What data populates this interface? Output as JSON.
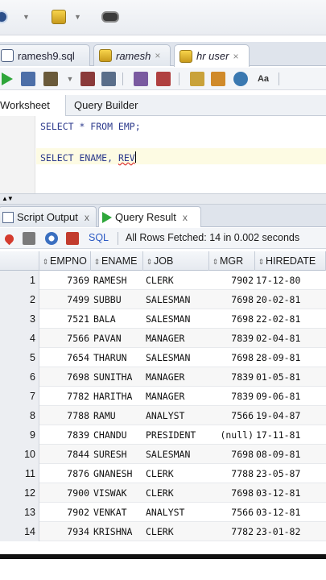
{
  "editor_tabs": [
    {
      "label": "ramesh9.sql",
      "close": "×"
    },
    {
      "label": "ramesh",
      "close": "×"
    },
    {
      "label": "hr user",
      "close": "×"
    }
  ],
  "worksheet_tabs": {
    "worksheet": "Worksheet",
    "query_builder": "Query Builder"
  },
  "editor": {
    "line1": "SELECT * FROM EMP;",
    "line2_prefix": "SELECT ENAME, ",
    "line2_error": "REV"
  },
  "result_tabs": [
    {
      "label": "Script Output",
      "close": "x"
    },
    {
      "label": "Query Result",
      "close": "x"
    }
  ],
  "result_toolbar": {
    "sql_label": "SQL",
    "fetch_status": "All Rows Fetched: 14 in 0.002 seconds"
  },
  "table": {
    "columns": [
      "EMPNO",
      "ENAME",
      "JOB",
      "MGR",
      "HIREDATE"
    ],
    "rows": [
      [
        "1",
        "7369",
        "RAMESH",
        "CLERK",
        "7902",
        "17-12-80"
      ],
      [
        "2",
        "7499",
        "SUBBU",
        "SALESMAN",
        "7698",
        "20-02-81"
      ],
      [
        "3",
        "7521",
        "BALA",
        "SALESMAN",
        "7698",
        "22-02-81"
      ],
      [
        "4",
        "7566",
        "PAVAN",
        "MANAGER",
        "7839",
        "02-04-81"
      ],
      [
        "5",
        "7654",
        "THARUN",
        "SALESMAN",
        "7698",
        "28-09-81"
      ],
      [
        "6",
        "7698",
        "SUNITHA",
        "MANAGER",
        "7839",
        "01-05-81"
      ],
      [
        "7",
        "7782",
        "HARITHA",
        "MANAGER",
        "7839",
        "09-06-81"
      ],
      [
        "8",
        "7788",
        "RAMU",
        "ANALYST",
        "7566",
        "19-04-87"
      ],
      [
        "9",
        "7839",
        "CHANDU",
        "PRESIDENT",
        "(null)",
        "17-11-81"
      ],
      [
        "10",
        "7844",
        "SURESH",
        "SALESMAN",
        "7698",
        "08-09-81"
      ],
      [
        "11",
        "7876",
        "GNANESH",
        "CLERK",
        "7788",
        "23-05-87"
      ],
      [
        "12",
        "7900",
        "VISWAK",
        "CLERK",
        "7698",
        "03-12-81"
      ],
      [
        "13",
        "7902",
        "VENKAT",
        "ANALYST",
        "7566",
        "03-12-81"
      ],
      [
        "14",
        "7934",
        "KRISHNA",
        "CLERK",
        "7782",
        "23-01-82"
      ]
    ]
  },
  "icons": {
    "run": "run-statement-icon",
    "sort": "sort-icon"
  }
}
